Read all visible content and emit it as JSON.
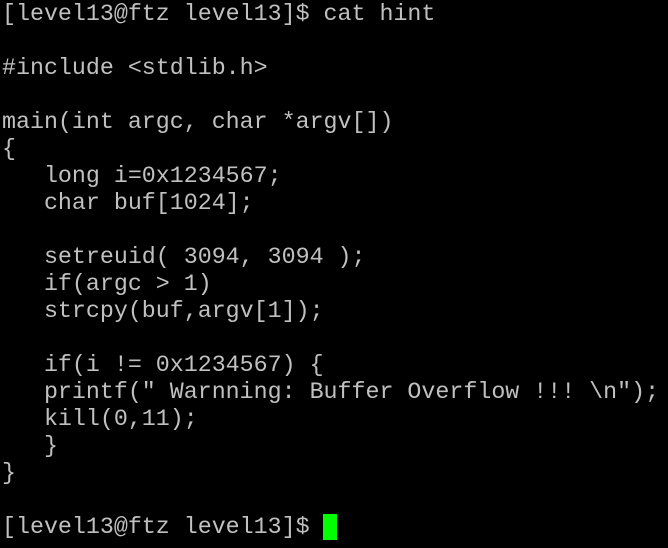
{
  "terminal": {
    "colors": {
      "background": "#000000",
      "foreground": "#c0c0c0",
      "cursor": "#00ff00"
    },
    "command_line": "[level13@ftz level13]$ cat hint",
    "code_lines": [
      "#include <stdlib.h>",
      "main(int argc, char *argv[])",
      "{",
      "   long i=0x1234567;",
      "   char buf[1024];",
      "   setreuid( 3094, 3094 );",
      "   if(argc > 1)",
      "   strcpy(buf,argv[1]);",
      "   if(i != 0x1234567) {",
      "   printf(\" Warnning: Buffer Overflow !!! \\n\");",
      "   kill(0,11);",
      "   }",
      "}"
    ],
    "prompt_line": "[level13@ftz level13]$ "
  }
}
